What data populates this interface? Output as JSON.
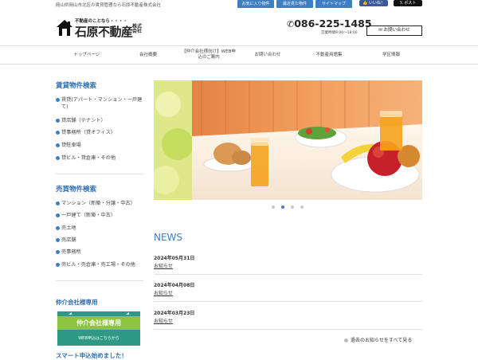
{
  "header": {
    "tagline": "岡山県岡山市北区の賃貸管理なら石原不動産株式会社",
    "top_links": [
      "お気に入り物件",
      "最近見た物件",
      "サイトマップ"
    ],
    "sns": {
      "like": "いいね！",
      "post": "ポスト"
    },
    "logo": {
      "subtitle": "不動産のことなら・・・・",
      "name": "石原不動産",
      "suffix": "株式会社"
    },
    "phone": "086-225-1485",
    "hours": "営業時間9:00～18:00",
    "contact_button": "お問い合わせ"
  },
  "nav": [
    {
      "label": "トップページ"
    },
    {
      "label": "会社概要"
    },
    {
      "label": "【仲介会社様向け】WEB申込のご案内"
    },
    {
      "label": "お問い合わせ"
    },
    {
      "label": "不動産用語集"
    },
    {
      "label": "学区情報"
    }
  ],
  "sidebar": {
    "rental_title": "賃貸物件検索",
    "rental_items": [
      "賃貸(アパート・マンション・一戸建て)",
      "貸店舗（テナント）",
      "貸事務所（貸オフィス）",
      "貸駐車場",
      "貸ビル・貸倉庫・その他"
    ],
    "sale_title": "売買物件検索",
    "sale_items": [
      "マンション（新築・分譲・中古）",
      "一戸建て（新築・中古）",
      "売土地",
      "売店舗",
      "売事務所",
      "売ビル・売倉庫・売工場・その他"
    ],
    "agent_title": "仲介会社様専用",
    "banner": {
      "title": "仲介会社様専用",
      "subtitle": "WEB申込はこちらから"
    },
    "smart_title": "スマート申込始めました！"
  },
  "slider": {
    "slide_count": 4,
    "active_index": 1
  },
  "news": {
    "title": "NEWS",
    "items": [
      {
        "date": "2024年05月31日",
        "category": "お知らせ"
      },
      {
        "date": "2024年04月08日",
        "category": "お知らせ"
      },
      {
        "date": "2024年03月23日",
        "category": "お知らせ"
      }
    ],
    "more_label": "過去のお知らせをすべて見る"
  },
  "colors": {
    "accent": "#3d7fc1",
    "banner": "#2e9a86",
    "facebook": "#3b5998"
  }
}
